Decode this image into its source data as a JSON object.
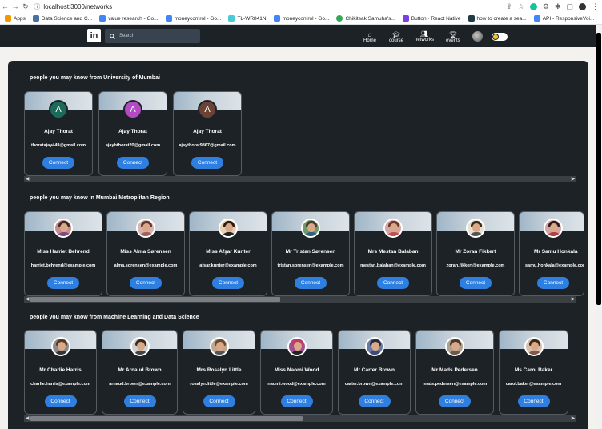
{
  "browser": {
    "url": "localhost:3000/networks",
    "bookmarks": [
      "Apps",
      "Data Science and C...",
      "value research - Go...",
      "moneycontrol - Go...",
      "TL-WR841N",
      "moneycontrol - Go...",
      "Chikitsak Samuha's...",
      "Button · React Native",
      "how to create a sea...",
      "API - ResponsiveVoi..."
    ]
  },
  "header": {
    "logo": "in",
    "search_placeholder": "Search",
    "nav": [
      {
        "label": "Home",
        "icon": "home-icon"
      },
      {
        "label": "course",
        "icon": "graduation-cap-icon"
      },
      {
        "label": "networks",
        "icon": "people-icon"
      },
      {
        "label": "events",
        "icon": "trophy-icon"
      }
    ]
  },
  "sections": [
    {
      "title": "people you may know from University of Mumbai",
      "people": [
        {
          "initial": "A",
          "avatar_color": "#1a6b5a",
          "name": "Ajay Thorat",
          "email": "thoratajay449@gmail.com"
        },
        {
          "initial": "A",
          "avatar_color": "#b44bc4",
          "name": "Ajay Thorat",
          "email": "ajaybthorat20@gmail.com"
        },
        {
          "initial": "A",
          "avatar_color": "#6b4336",
          "name": "Ajay Thorat",
          "email": "ajaythorat9867@gmail.com"
        }
      ]
    },
    {
      "title": "people you may know in Mumbai Metroplitan Region",
      "people": [
        {
          "name": "Miss Harriet Behrend",
          "email": "harriet.behrend@example.com"
        },
        {
          "name": "Miss Alma Sørensen",
          "email": "alma.sorensen@example.com"
        },
        {
          "name": "Miss Afşar Kunter",
          "email": "afsar.kunter@example.com"
        },
        {
          "name": "Mr Tristan Sørensen",
          "email": "tristan.sorensen@example.com"
        },
        {
          "name": "Mrs Mestan Balaban",
          "email": "mestan.balaban@example.com"
        },
        {
          "name": "Mr Zoran Fikkert",
          "email": "zoran.fikkert@example.com"
        },
        {
          "name": "Mr Samu Honkala",
          "email": "samu.honkala@example.com"
        }
      ]
    },
    {
      "title": "people you may know from Machine Learning and Data Science",
      "people": [
        {
          "name": "Mr Charlie Harris",
          "email": "charlie.harris@example.com"
        },
        {
          "name": "Mr Arnaud Brown",
          "email": "arnaud.brown@example.com"
        },
        {
          "name": "Mrs Rosalyn Little",
          "email": "rosalyn.little@example.com"
        },
        {
          "name": "Miss Naomi Wood",
          "email": "naomi.wood@example.com"
        },
        {
          "name": "Mr Carter Brown",
          "email": "carter.brown@example.com"
        },
        {
          "name": "Mr Mads Pedersen",
          "email": "mads.pedersen@example.com"
        },
        {
          "name": "Ms Carol Baker",
          "email": "carol.baker@example.com"
        }
      ]
    }
  ],
  "connect_label": "Connect"
}
